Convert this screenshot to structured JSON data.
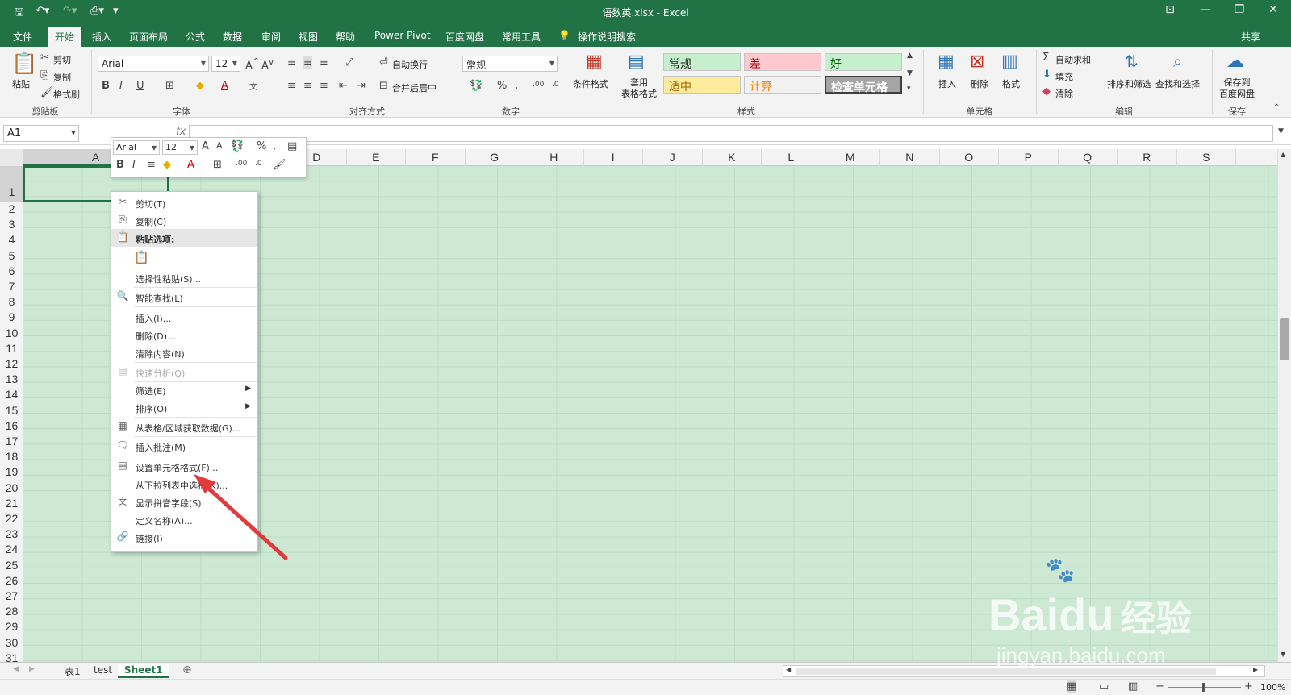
{
  "window": {
    "title": "语数英.xlsx - Excel",
    "share": "共享"
  },
  "tabs": [
    "文件",
    "开始",
    "插入",
    "页面布局",
    "公式",
    "数据",
    "审阅",
    "视图",
    "帮助",
    "Power Pivot",
    "百度网盘",
    "常用工具"
  ],
  "active_tab": "开始",
  "search_placeholder": "操作说明搜索",
  "ribbon": {
    "clipboard": {
      "paste": "粘贴",
      "cut": "剪切",
      "copy": "复制",
      "format_painter": "格式刷",
      "label": "剪贴板"
    },
    "font": {
      "name": "Arial",
      "size": "12",
      "label": "字体"
    },
    "alignment": {
      "wrap": "自动换行",
      "merge": "合并后居中",
      "label": "对齐方式"
    },
    "number": {
      "format": "常规",
      "label": "数字"
    },
    "styles": {
      "conditional": "条件格式",
      "table_format": "套用\n表格格式",
      "cells": [
        {
          "label": "常规",
          "bg": "#c6efce",
          "color": "#222222"
        },
        {
          "label": "差",
          "bg": "#ffc7ce",
          "color": "#9c0006"
        },
        {
          "label": "好",
          "bg": "#c6efce",
          "color": "#006100"
        },
        {
          "label": "适中",
          "bg": "#ffeb9c",
          "color": "#9c6500"
        },
        {
          "label": "计算",
          "bg": "#f2f2f2",
          "color": "#fa7d00"
        },
        {
          "label": "检查单元格",
          "bg": "#a5a5a5",
          "color": "#ffffff"
        }
      ],
      "label": "样式"
    },
    "cells": {
      "insert": "插入",
      "delete": "删除",
      "format": "格式",
      "label": "单元格"
    },
    "editing": {
      "autosum": "自动求和",
      "fill": "填充",
      "clear": "清除",
      "sort_filter": "排序和筛选",
      "find_select": "查找和选择",
      "label": "编辑"
    },
    "save": {
      "save_to": "保存到\n百度网盘",
      "label": "保存"
    }
  },
  "formula_bar": {
    "name_box": "A1",
    "fx": "fx"
  },
  "columns": [
    "A",
    "B",
    "C",
    "D",
    "E",
    "F",
    "G",
    "H",
    "I",
    "J",
    "K",
    "L",
    "M",
    "N",
    "O",
    "P",
    "Q",
    "R",
    "S"
  ],
  "rows": [
    "1",
    "2",
    "3",
    "4",
    "5",
    "6",
    "7",
    "8",
    "9",
    "10",
    "11",
    "12",
    "13",
    "14",
    "15",
    "16",
    "17",
    "18",
    "19",
    "20",
    "21",
    "22",
    "23",
    "24",
    "25",
    "26",
    "27",
    "28",
    "29",
    "30",
    "31"
  ],
  "mini_toolbar": {
    "font": "Arial",
    "size": "12"
  },
  "context_menu": {
    "cut": "剪切(T)",
    "copy": "复制(C)",
    "paste_options": "粘贴选项:",
    "paste_special": "选择性粘贴(S)...",
    "smart_lookup": "智能查找(L)",
    "insert": "插入(I)...",
    "delete": "删除(D)...",
    "clear": "清除内容(N)",
    "quick_analysis": "快速分析(Q)",
    "filter": "筛选(E)",
    "sort": "排序(O)",
    "get_data": "从表格/区域获取数据(G)...",
    "insert_comment": "插入批注(M)",
    "format_cells": "设置单元格格式(F)...",
    "dropdown_pick": "从下拉列表中选择(K)...",
    "phonetic": "显示拼音字段(S)",
    "define_name": "定义名称(A)...",
    "link": "链接(I)"
  },
  "sheets": [
    "表1",
    "test",
    "Sheet1"
  ],
  "active_sheet": "Sheet1",
  "zoom": "100%",
  "watermark": {
    "brand": "Bai",
    "brand2": "du",
    "cn": "经验",
    "url": "jingyan.baidu.com"
  },
  "colors": {
    "accent": "#217346",
    "grid": "#cde8d3",
    "arrow": "#e0393e"
  }
}
